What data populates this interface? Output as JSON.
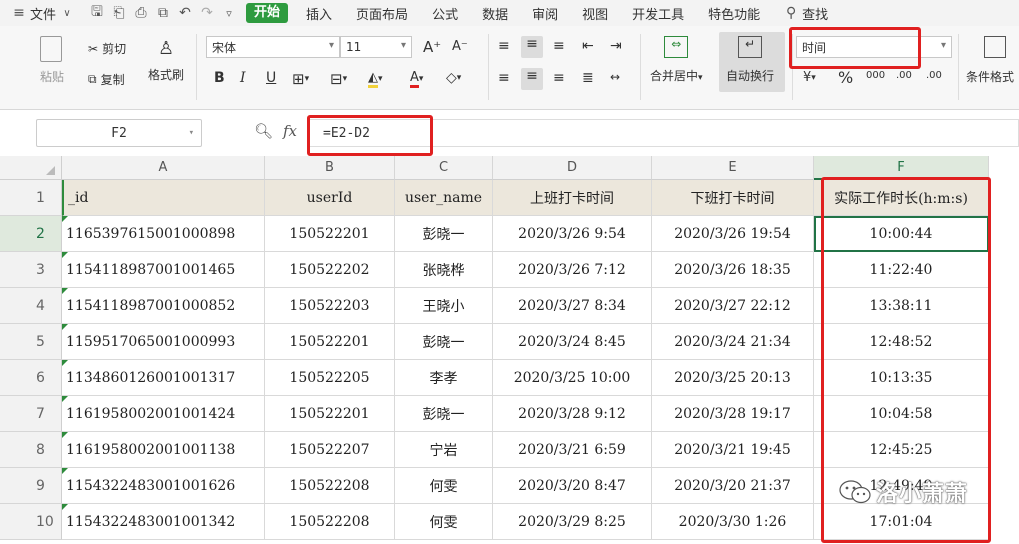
{
  "menu": {
    "file_label": "文件",
    "start_label": "开始",
    "tabs": [
      "插入",
      "页面布局",
      "公式",
      "数据",
      "审阅",
      "视图",
      "开发工具",
      "特色功能"
    ],
    "search_label": "查找"
  },
  "ribbon": {
    "paste_label": "粘贴",
    "cut_label": "剪切",
    "copy_label": "复制",
    "format_painter_label": "格式刷",
    "font_name": "宋体",
    "font_size": "11",
    "bold": "B",
    "italic": "I",
    "underline": "U",
    "merge_center_label": "合并居中",
    "wrap_text_label": "自动换行",
    "number_format": "时间",
    "percent": "%",
    "thousands": "000",
    "inc_decimal": ".00",
    "dec_decimal": ".00",
    "conditional_format_label": "条件格式"
  },
  "formula_bar": {
    "cell_ref": "F2",
    "fx": "fx",
    "formula": "=E2-D2"
  },
  "sheet": {
    "columns": [
      "A",
      "B",
      "C",
      "D",
      "E",
      "F"
    ],
    "row_numbers": [
      "1",
      "2",
      "3",
      "4",
      "5",
      "6",
      "7",
      "8",
      "9",
      "10"
    ],
    "headers": [
      "_id",
      "userId",
      "user_name",
      "上班打卡时间",
      "下班打卡时间",
      "实际工作时长(h:m:s)"
    ],
    "rows": [
      [
        "1165397615001000898",
        "150522201",
        "彭晓一",
        "2020/3/26 9:54",
        "2020/3/26 19:54",
        "10:00:44"
      ],
      [
        "1154118987001001465",
        "150522202",
        "张晓桦",
        "2020/3/26 7:12",
        "2020/3/26 18:35",
        "11:22:40"
      ],
      [
        "1154118987001000852",
        "150522203",
        "王晓小",
        "2020/3/27 8:34",
        "2020/3/27 22:12",
        "13:38:11"
      ],
      [
        "1159517065001000993",
        "150522201",
        "彭晓一",
        "2020/3/24 8:45",
        "2020/3/24 21:34",
        "12:48:52"
      ],
      [
        "1134860126001001317",
        "150522205",
        "李孝",
        "2020/3/25 10:00",
        "2020/3/25 20:13",
        "10:13:35"
      ],
      [
        "1161958002001001424",
        "150522201",
        "彭晓一",
        "2020/3/28 9:12",
        "2020/3/28 19:17",
        "10:04:58"
      ],
      [
        "1161958002001001138",
        "150522207",
        "宁岩",
        "2020/3/21 6:59",
        "2020/3/21 19:45",
        "12:45:25"
      ],
      [
        "1154322483001001626",
        "150522208",
        "何雯",
        "2020/3/20 8:47",
        "2020/3/20 21:37",
        "12:49:49"
      ],
      [
        "1154322483001001342",
        "150522208",
        "何雯",
        "2020/3/29 8:25",
        "2020/3/30 1:26",
        "17:01:04"
      ]
    ]
  },
  "watermark": "洛小萧萧",
  "colors": {
    "accent_green": "#217346",
    "start_green": "#2e9b3f",
    "highlight_red": "#e02020",
    "header_fill": "#ece7dc"
  }
}
